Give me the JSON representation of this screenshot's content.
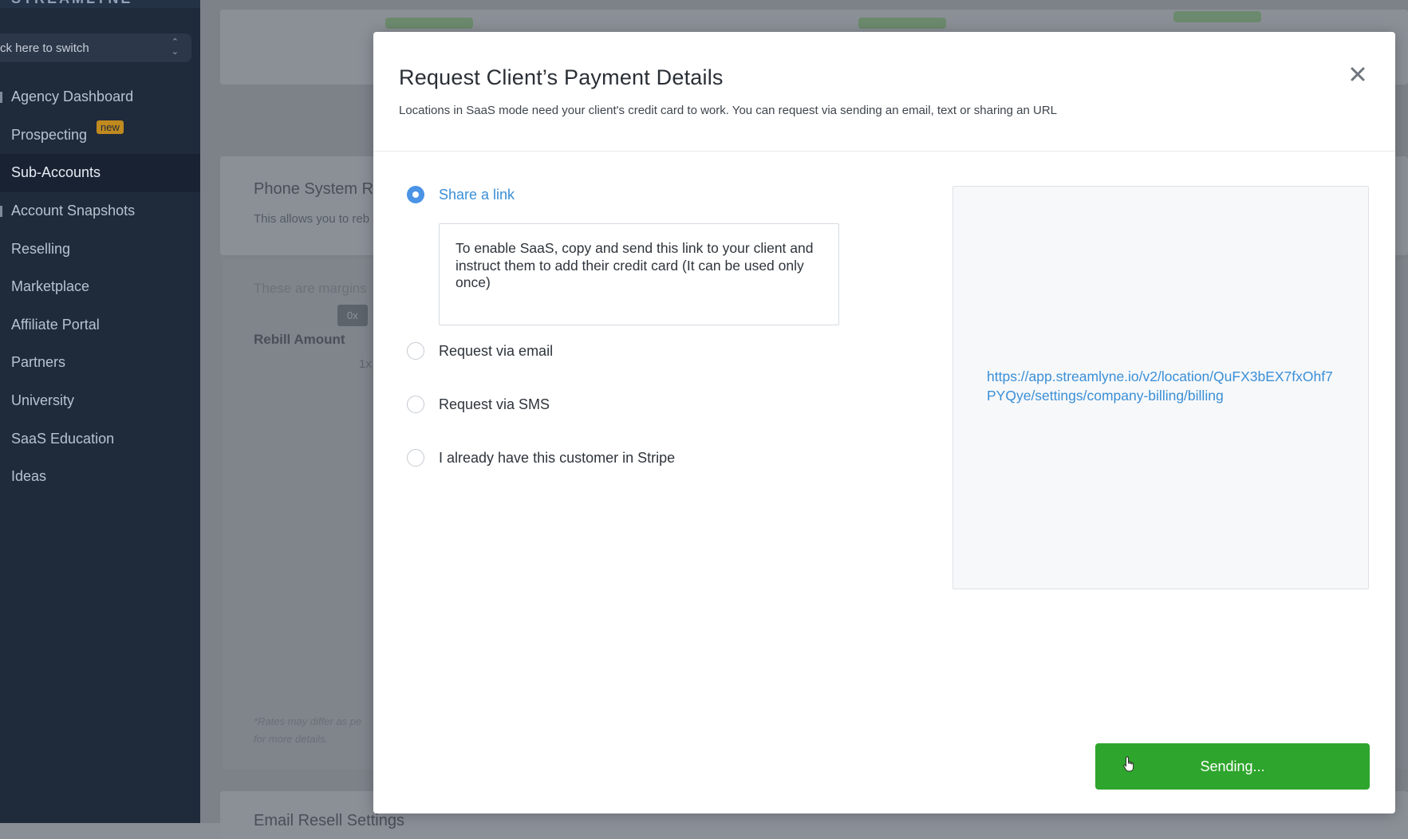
{
  "sidebar": {
    "logo": "STREAMLYNE",
    "switcher": "ck here to switch",
    "items": [
      {
        "label": "Agency Dashboard"
      },
      {
        "label": "Prospecting",
        "badge": "new"
      },
      {
        "label": "Sub-Accounts"
      },
      {
        "label": "Account Snapshots"
      },
      {
        "label": "Reselling"
      },
      {
        "label": "Marketplace"
      },
      {
        "label": "Affiliate Portal"
      },
      {
        "label": "Partners"
      },
      {
        "label": "University"
      },
      {
        "label": "SaaS Education"
      },
      {
        "label": "Ideas"
      }
    ]
  },
  "background": {
    "section_title": "Phone System R",
    "section_desc": "This allows you to reb",
    "margins_text": "These are margins",
    "tag_0x": "0x",
    "rebill_label": "Rebill Amount",
    "tick_1x": "1x",
    "footnote_1": "*Rates may differ as pe",
    "footnote_2": "for more details.",
    "bottom_title": "Email Resell Settings"
  },
  "modal": {
    "title": "Request Client’s Payment Details",
    "subtitle": "Locations in SaaS mode need your client's credit card to work. You can request via sending an email, text or sharing an URL",
    "options": [
      {
        "label": "Share a link",
        "checked": true
      },
      {
        "label": "Request via email",
        "checked": false
      },
      {
        "label": "Request via SMS",
        "checked": false
      },
      {
        "label": "I already have this customer in Stripe",
        "checked": false
      }
    ],
    "note": "To enable SaaS, copy and send this link to your client and instruct them to add their credit card (It can be used only once)",
    "link_url": "https://app.streamlyne.io/v2/location/QuFX3bEX7fxOhf7PYQye/settings/company-billing/billing",
    "send_button": "Sending...",
    "colors": {
      "primary_blue": "#3a8fd6",
      "send_green": "#2ea52c"
    }
  }
}
